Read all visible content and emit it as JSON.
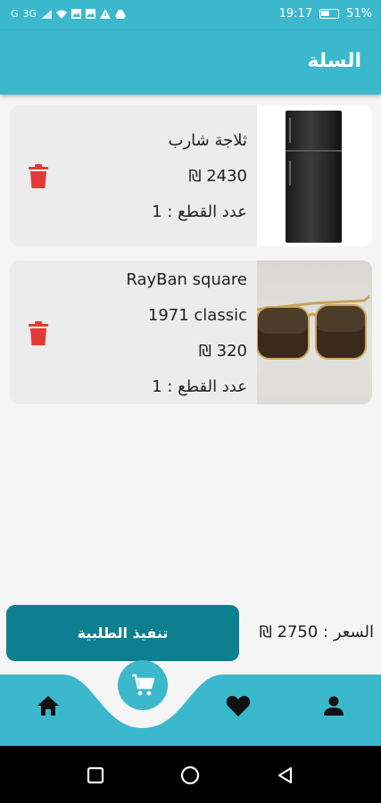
{
  "status_bar": {
    "left_icons": [
      "G",
      "3G",
      "signal",
      "wifi",
      "image",
      "image",
      "warning",
      "drive"
    ],
    "time": "19:17",
    "battery": "51%"
  },
  "header": {
    "title": "السلة"
  },
  "cart": {
    "items": [
      {
        "name": "ثلاجة شارب",
        "name_line2": "",
        "price": "2430 ₪",
        "quantity": "عدد القطع : 1"
      },
      {
        "name": "RayBan square",
        "name_line2": "1971 classic",
        "price": "320 ₪",
        "quantity": "عدد القطع : 1"
      }
    ]
  },
  "checkout": {
    "button_label": "تنفيذ الطلبية",
    "total": "السعر : 2750 ₪"
  },
  "bottom_nav": {
    "items": [
      "home-icon",
      "cart-icon",
      "heart-icon",
      "profile-icon"
    ],
    "active": "cart"
  },
  "colors": {
    "primary": "#3bb8cc",
    "button": "#0e7f8f",
    "delete": "#e53935"
  }
}
